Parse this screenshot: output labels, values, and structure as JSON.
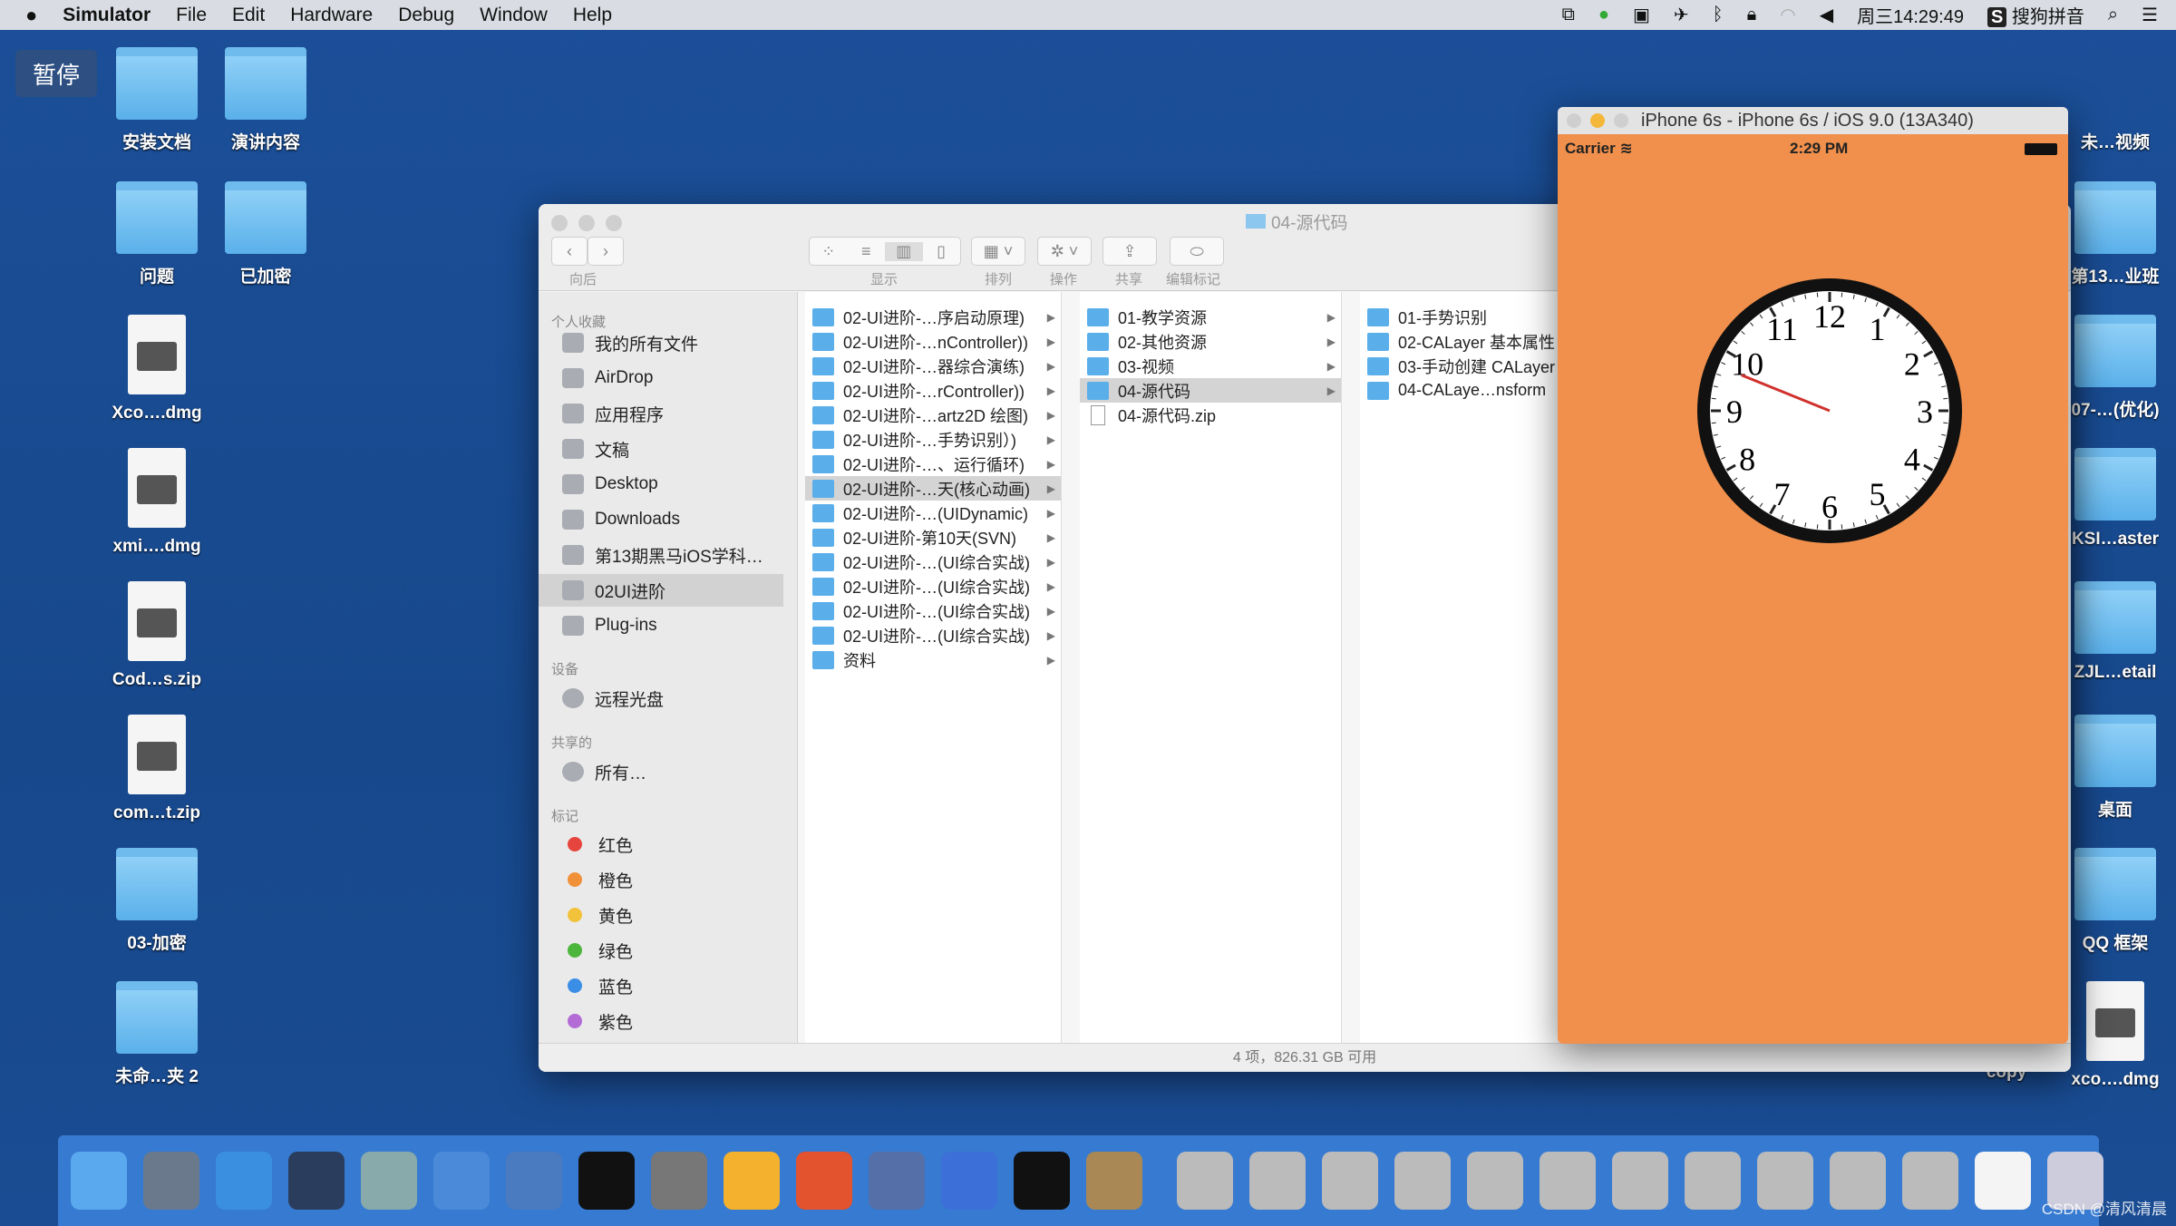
{
  "menubar": {
    "apple": "",
    "app": "Simulator",
    "items": [
      "File",
      "Edit",
      "Hardware",
      "Debug",
      "Window",
      "Help"
    ],
    "clock": "周三14:29:49",
    "input_method": "搜狗拼音"
  },
  "pause_label": "暂停",
  "desktop_left": [
    {
      "label": "安装文档",
      "type": "folder"
    },
    {
      "label": "演讲内容",
      "type": "folder"
    },
    {
      "label": "问题",
      "type": "folder"
    },
    {
      "label": "已加密",
      "type": "folder"
    },
    {
      "label": "Xco….dmg",
      "type": "file"
    },
    {
      "label": "xmi….dmg",
      "type": "file"
    },
    {
      "label": "Cod…s.zip",
      "type": "file"
    },
    {
      "label": "com…t.zip",
      "type": "file"
    },
    {
      "label": "03-加密",
      "type": "folder"
    },
    {
      "label": "未命…夹 2",
      "type": "folder"
    }
  ],
  "desktop_right": [
    {
      "label": "未…视频"
    },
    {
      "label": "第13…业班"
    },
    {
      "label": "07-…(优化)"
    },
    {
      "label": "KSI…aster"
    },
    {
      "label": "ZJL…etail"
    },
    {
      "label": "桌面"
    },
    {
      "label": "QQ 框架"
    },
    {
      "label": "xco….dmg"
    },
    {
      "label": "copy"
    }
  ],
  "finder": {
    "title": "04-源代码",
    "toolbar": {
      "back_label": "向后",
      "view_label": "显示",
      "arrange_label": "排列",
      "action_label": "操作",
      "share_label": "共享",
      "tags_label": "编辑标记"
    },
    "sidebar": {
      "favorites_header": "个人收藏",
      "favorites": [
        "我的所有文件",
        "AirDrop",
        "应用程序",
        "文稿",
        "Desktop",
        "Downloads",
        "第13期黑马iOS学科…",
        "02UI进阶",
        "Plug-ins"
      ],
      "devices_header": "设备",
      "devices": [
        "远程光盘"
      ],
      "shared_header": "共享的",
      "shared": [
        "所有…"
      ],
      "tags_header": "标记",
      "tags": [
        {
          "label": "红色",
          "color": "#e5453c"
        },
        {
          "label": "橙色",
          "color": "#f0913a"
        },
        {
          "label": "黄色",
          "color": "#f2c23b"
        },
        {
          "label": "绿色",
          "color": "#4cb63c"
        },
        {
          "label": "蓝色",
          "color": "#3a8ee6"
        },
        {
          "label": "紫色",
          "color": "#b36bd6"
        }
      ]
    },
    "col1": [
      "02-UI进阶-…序启动原理)",
      "02-UI进阶-…nController))",
      "02-UI进阶-…器综合演练)",
      "02-UI进阶-…rController))",
      "02-UI进阶-…artz2D 绘图)",
      "02-UI进阶-…手势识别）)",
      "02-UI进阶-…、运行循环)",
      "02-UI进阶-…天(核心动画)",
      "02-UI进阶-…(UIDynamic)",
      "02-UI进阶-第10天(SVN)",
      "02-UI进阶-…(UI综合实战)",
      "02-UI进阶-…(UI综合实战)",
      "02-UI进阶-…(UI综合实战)",
      "02-UI进阶-…(UI综合实战)",
      "资料"
    ],
    "col1_selected": 7,
    "col2": [
      "01-教学资源",
      "02-其他资源",
      "03-视频",
      "04-源代码",
      "04-源代码.zip"
    ],
    "col2_selected": 3,
    "col3": [
      "01-手势识别",
      "02-CALayer 基本属性",
      "03-手动创建 CALayer",
      "04-CALaye…nsform"
    ],
    "status": "4 项，826.31 GB 可用"
  },
  "simulator": {
    "title": "iPhone 6s - iPhone 6s / iOS 9.0 (13A340)",
    "carrier": "Carrier",
    "time": "2:29 PM",
    "background": "#f0904c",
    "clock_numbers": [
      "12",
      "1",
      "2",
      "3",
      "4",
      "5",
      "6",
      "7",
      "8",
      "9",
      "10",
      "11"
    ]
  },
  "dock": [
    "finder",
    "launchpad",
    "safari",
    "mouse",
    "preview",
    "xcode",
    "instruments",
    "terminal",
    "system-preferences",
    "sketch",
    "powerpoint",
    "quicktime",
    "teamviewer",
    "console",
    "media-player",
    "screenshot-1",
    "screenshot-2",
    "screenshot-3",
    "screenshot-4",
    "screenshot-5",
    "screenshot-6",
    "screenshot-7",
    "screenshot-8",
    "screenshot-9",
    "screenshot-10",
    "screenshot-11",
    "document",
    "trash"
  ],
  "watermark": "CSDN @清风清晨"
}
